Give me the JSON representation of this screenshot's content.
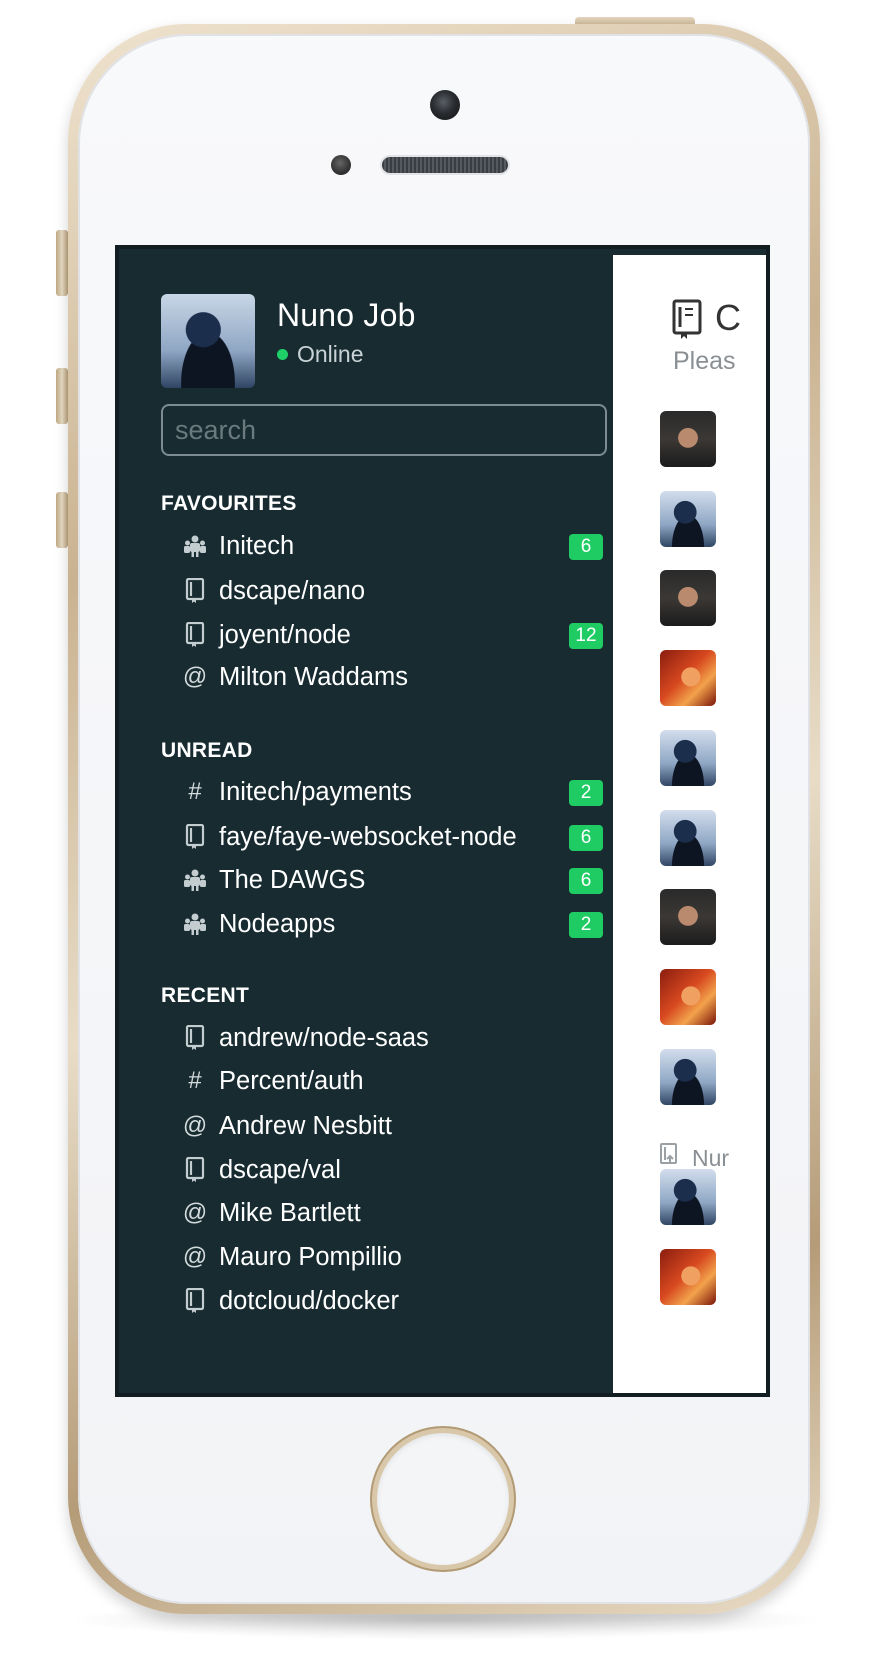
{
  "profile": {
    "name": "Nuno Job",
    "status": "Online"
  },
  "search": {
    "placeholder": "search"
  },
  "sections": {
    "favourites": {
      "title": "FAVOURITES",
      "items": [
        {
          "label": "Initech",
          "icon": "org-icon",
          "badge": "6"
        },
        {
          "label": "dscape/nano",
          "icon": "repo-icon"
        },
        {
          "label": "joyent/node",
          "icon": "repo-icon",
          "badge": "12"
        },
        {
          "label": "Milton Waddams",
          "icon": "at-icon",
          "glyph": "@"
        }
      ]
    },
    "unread": {
      "title": "UNREAD",
      "items": [
        {
          "label": "Initech/payments",
          "icon": "hash-icon",
          "glyph": "#",
          "badge": "2"
        },
        {
          "label": "faye/faye-websocket-node",
          "icon": "repo-icon",
          "badge": "6"
        },
        {
          "label": "The DAWGS",
          "icon": "org-icon",
          "badge": "6"
        },
        {
          "label": "Nodeapps",
          "icon": "org-icon",
          "badge": "2"
        }
      ]
    },
    "recent": {
      "title": "RECENT",
      "items": [
        {
          "label": "andrew/node-saas",
          "icon": "repo-icon"
        },
        {
          "label": "Percent/auth",
          "icon": "hash-icon",
          "glyph": "#"
        },
        {
          "label": "Andrew Nesbitt",
          "icon": "at-icon",
          "glyph": "@"
        },
        {
          "label": "dscape/val",
          "icon": "repo-icon"
        },
        {
          "label": "Mike Bartlett",
          "icon": "at-icon",
          "glyph": "@"
        },
        {
          "label": "Mauro Pompillio",
          "icon": "at-icon",
          "glyph": "@"
        },
        {
          "label": "dotcloud/docker",
          "icon": "repo-icon"
        }
      ]
    }
  },
  "content": {
    "title_partial": "C",
    "subtitle_partial": "Pleas",
    "event_text_partial": "Nur"
  },
  "colors": {
    "sidebar_bg": "#172b31",
    "badge": "#1fcc64",
    "status_online": "#1fd068"
  }
}
